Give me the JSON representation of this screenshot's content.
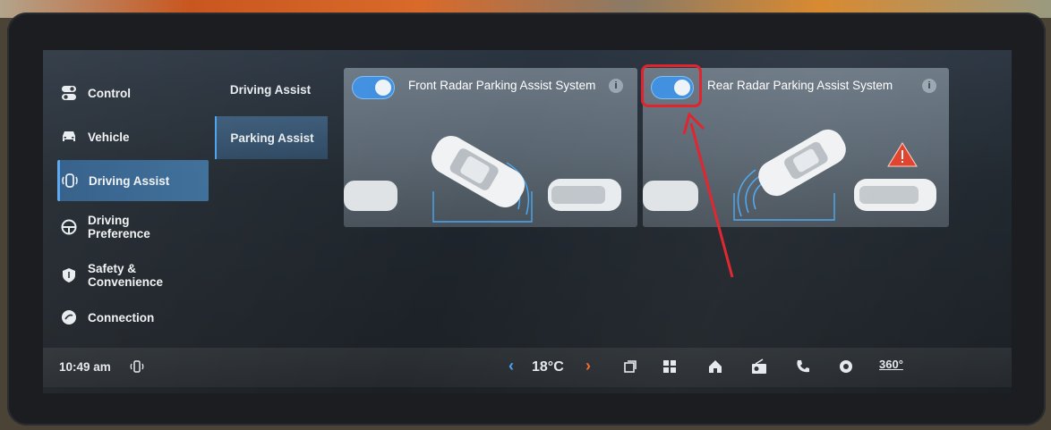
{
  "sidebar": {
    "items": [
      {
        "label": "Control",
        "icon": "toggle-switches-icon"
      },
      {
        "label": "Vehicle",
        "icon": "car-icon"
      },
      {
        "label": "Driving Assist",
        "icon": "driving-assist-icon",
        "active": true
      },
      {
        "label": "Driving Preference",
        "line1": "Driving",
        "line2": "Preference",
        "icon": "steering-wheel-icon"
      },
      {
        "label": "Safety & Convenience",
        "line1": "Safety &",
        "line2": "Convenience",
        "icon": "shield-icon"
      },
      {
        "label": "Connection",
        "icon": "connection-icon"
      }
    ]
  },
  "subnav": {
    "items": [
      {
        "label": "Driving Assist"
      },
      {
        "label": "Parking Assist",
        "active": true
      }
    ]
  },
  "cards": {
    "front": {
      "title": "Front Radar Parking Assist System",
      "toggle_on": true,
      "info": "i"
    },
    "rear": {
      "title": "Rear Radar Parking Assist System",
      "toggle_on": true,
      "info": "i"
    }
  },
  "statusbar": {
    "time": "10:49 am",
    "temperature": "18°C",
    "view360": "360°",
    "icons": [
      "phone-connected-icon",
      "temp-down-chevron-icon",
      "temp-up-chevron-icon",
      "multi-window-icon",
      "apps-grid-icon",
      "home-icon",
      "media-icon",
      "phone-icon",
      "settings-icon",
      "camera-360-icon"
    ]
  },
  "colors": {
    "accent": "#3f8fe0",
    "active_bg": "#2d5a86",
    "warning": "#e0402a",
    "annotation": "#e0202a"
  }
}
